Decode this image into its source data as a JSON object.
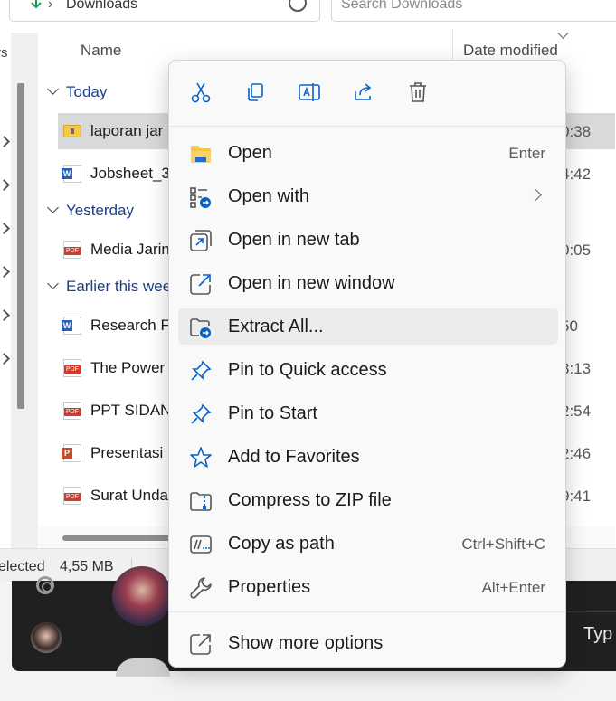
{
  "address": {
    "crumb": "Downloads",
    "search_placeholder": "Search Downloads"
  },
  "nav_partial_label": "rs",
  "columns": {
    "name": "Name",
    "date_modified": "Date modified"
  },
  "groups": [
    {
      "label": "Today"
    },
    {
      "label": "Yesterday"
    },
    {
      "label": "Earlier this wee"
    }
  ],
  "files": [
    {
      "name": "laporan jar",
      "date": "0:38",
      "type": "zip",
      "selected": true
    },
    {
      "name": "Jobsheet_3",
      "date": "4:42",
      "type": "word"
    },
    {
      "name": "Media Jarin",
      "date": "0:05",
      "type": "pdf"
    },
    {
      "name": "Research Fi",
      "date": "50",
      "type": "word"
    },
    {
      "name": "The Power",
      "date": "3:13",
      "type": "pdf"
    },
    {
      "name": "PPT SIDAN",
      "date": "2:54",
      "type": "pdf"
    },
    {
      "name": "Presentasi",
      "date": "2:46",
      "type": "ppt"
    },
    {
      "name": "Surat Unda",
      "date": "9:41",
      "type": "pdf"
    }
  ],
  "status": {
    "selected": "elected",
    "size": "4,55 MB"
  },
  "taskbar": {
    "type_text": "Typ"
  },
  "context_menu": {
    "toolbar": [
      {
        "name": "cut-icon",
        "icon": "scissors"
      },
      {
        "name": "copy-icon",
        "icon": "copy"
      },
      {
        "name": "rename-icon",
        "icon": "rename"
      },
      {
        "name": "share-icon",
        "icon": "share"
      },
      {
        "name": "delete-icon",
        "icon": "trash"
      }
    ],
    "items": [
      {
        "label": "Open",
        "shortcut": "Enter",
        "icon": "folder"
      },
      {
        "label": "Open with",
        "shortcut": "",
        "icon": "open-with",
        "submenu": true
      },
      {
        "label": "Open in new tab",
        "shortcut": "",
        "icon": "new-tab"
      },
      {
        "label": "Open in new window",
        "shortcut": "",
        "icon": "new-window"
      },
      {
        "label": "Extract All...",
        "shortcut": "",
        "icon": "extract",
        "highlighted": true
      },
      {
        "label": "Pin to Quick access",
        "shortcut": "",
        "icon": "pin"
      },
      {
        "label": "Pin to Start",
        "shortcut": "",
        "icon": "pin"
      },
      {
        "label": "Add to Favorites",
        "shortcut": "",
        "icon": "star"
      },
      {
        "label": "Compress to ZIP file",
        "shortcut": "",
        "icon": "zip-folder"
      },
      {
        "label": "Copy as path",
        "shortcut": "Ctrl+Shift+C",
        "icon": "path"
      },
      {
        "label": "Properties",
        "shortcut": "Alt+Enter",
        "icon": "wrench"
      },
      {
        "label": "Show more options",
        "shortcut": "",
        "icon": "more-options"
      }
    ]
  },
  "colors": {
    "accent": "#0a63c9",
    "group_text": "#1c3e8a",
    "taskbar": "#202020"
  }
}
